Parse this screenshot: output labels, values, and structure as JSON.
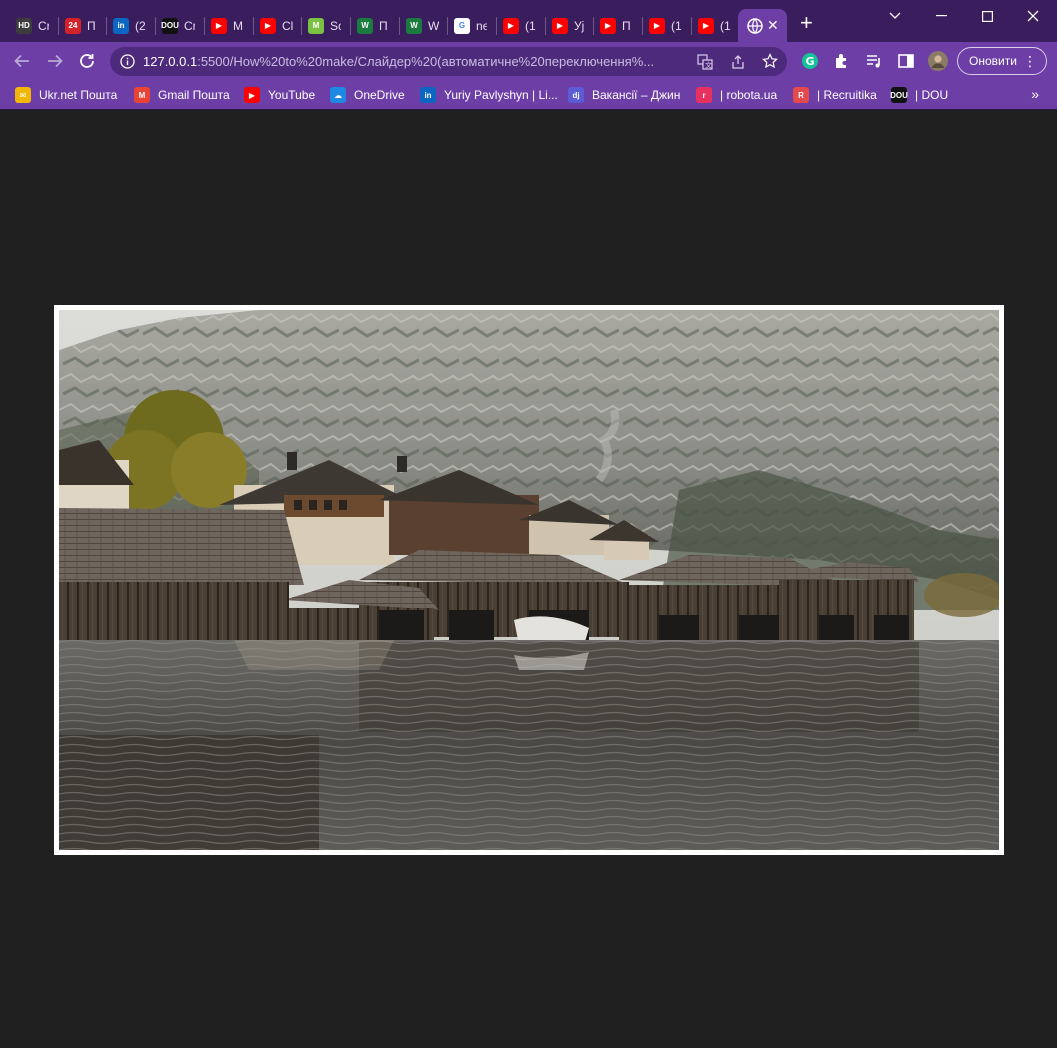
{
  "browser": {
    "tabs": [
      {
        "label": "Cr",
        "icon": "hd-icon",
        "color": "#3c3c3c",
        "glyph": "HD"
      },
      {
        "label": "П",
        "icon": "news24-icon",
        "color": "#d2232a",
        "glyph": "24"
      },
      {
        "label": "(2",
        "icon": "linkedin-icon",
        "color": "#0a66c2",
        "glyph": "in"
      },
      {
        "label": "Cr",
        "icon": "dou-icon",
        "color": "#111111",
        "glyph": "DOU"
      },
      {
        "label": "M",
        "icon": "youtube-icon",
        "color": "#ff0000",
        "glyph": "▶"
      },
      {
        "label": "Cl",
        "icon": "youtube-icon",
        "color": "#ff0000",
        "glyph": "▶"
      },
      {
        "label": "Sc",
        "icon": "m-logo-icon",
        "color": "#7cc242",
        "glyph": "M"
      },
      {
        "label": "П",
        "icon": "w-logo-icon",
        "color": "#1b7a3e",
        "glyph": "W"
      },
      {
        "label": "W",
        "icon": "w-logo-icon",
        "color": "#1b7a3e",
        "glyph": "W"
      },
      {
        "label": "ne",
        "icon": "google-icon",
        "color": "#ffffff",
        "glyph": "G"
      },
      {
        "label": "(1",
        "icon": "youtube-icon",
        "color": "#ff0000",
        "glyph": "▶"
      },
      {
        "label": "Уј",
        "icon": "youtube-icon",
        "color": "#ff0000",
        "glyph": "▶"
      },
      {
        "label": "П",
        "icon": "youtube-icon",
        "color": "#ff0000",
        "glyph": "▶"
      },
      {
        "label": "(1",
        "icon": "youtube-icon",
        "color": "#ff0000",
        "glyph": "▶"
      },
      {
        "label": "(1",
        "icon": "youtube-icon",
        "color": "#ff0000",
        "glyph": "▶"
      }
    ],
    "active_tab": {
      "icon": "globe-icon",
      "close": "✕"
    },
    "new_tab": "+",
    "address": {
      "host": "127.0.0.1",
      "path": ":5500/How%20to%20make/Слайдер%20(автоматичне%20переключення%..."
    },
    "update_button": "Оновити",
    "bookmarks": [
      {
        "label": "Ukr.net Пошта",
        "icon": "ukrnet-icon",
        "color": "#f2b705",
        "glyph": "✉"
      },
      {
        "label": "Gmail Пошта",
        "icon": "gmail-icon",
        "color": "#ea4335",
        "glyph": "M"
      },
      {
        "label": "YouTube",
        "icon": "youtube-icon",
        "color": "#ff0000",
        "glyph": "▶"
      },
      {
        "label": "OneDrive",
        "icon": "onedrive-icon",
        "color": "#1e88e5",
        "glyph": "☁"
      },
      {
        "label": "Yuriy Pavlyshyn | Li...",
        "icon": "linkedin-icon",
        "color": "#0a66c2",
        "glyph": "in"
      },
      {
        "label": "Вакансії – Джин",
        "icon": "djinni-icon",
        "color": "#5b5bd6",
        "glyph": "dj"
      },
      {
        "label": "| robota.ua",
        "icon": "robota-icon",
        "color": "#e8315f",
        "glyph": "r"
      },
      {
        "label": "| Recruitika",
        "icon": "recruitika-icon",
        "color": "#e5484d",
        "glyph": "R"
      },
      {
        "label": "| DOU",
        "icon": "dou-icon",
        "color": "#111111",
        "glyph": "DOU"
      }
    ],
    "bookmarks_more": "»"
  },
  "page": {
    "background": "#202020",
    "slider": {
      "frame_color": "#ffffff"
    }
  }
}
